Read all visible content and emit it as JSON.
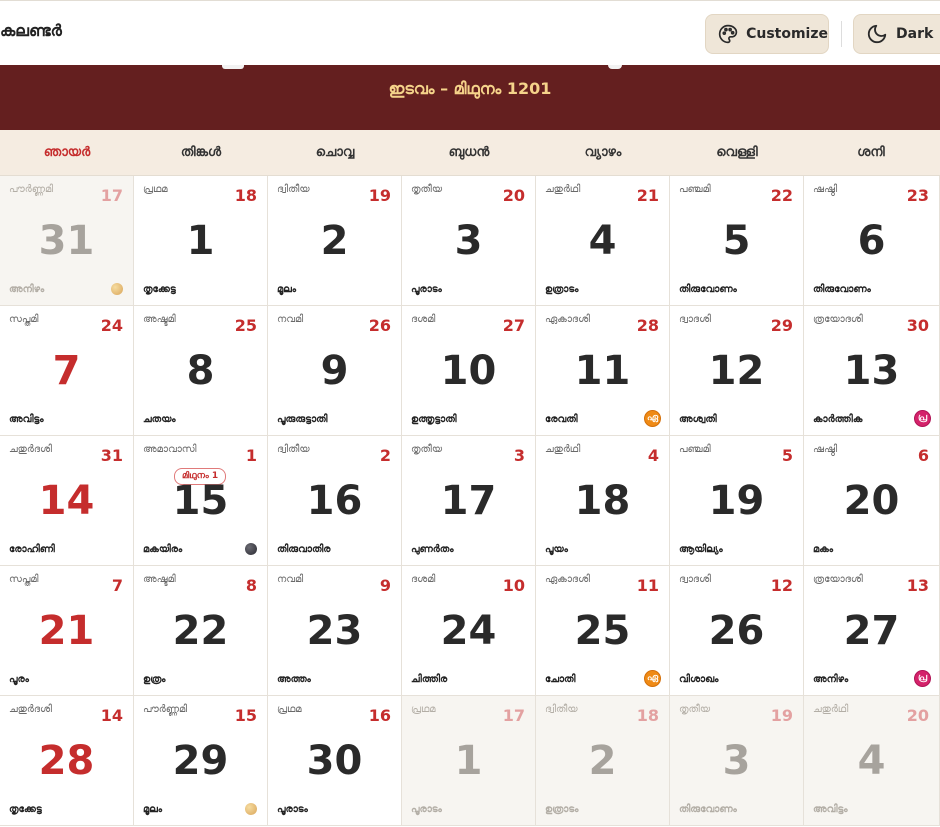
{
  "header": {
    "app_title": "കലണ്ടർ",
    "customize_label": "Customize",
    "dark_label": "Dark"
  },
  "banner": {
    "subtitle": "ഇടവം – മിഥുനം 1201"
  },
  "weekdays": [
    "ഞായർ",
    "തിങ്കൾ",
    "ചൊവ്വ",
    "ബുധൻ",
    "വ്യാഴം",
    "വെള്ളി",
    "ശനി"
  ],
  "colors": {
    "banner": "#641f1f",
    "accent_red": "#c52d2d",
    "header_bg": "#f5ece1",
    "button_bg": "#efe6d8"
  },
  "weeks": [
    [
      {
        "tithi": "പൗർണ്ണമി",
        "mdate": "17",
        "day": "31",
        "star": "അനിഴം",
        "other": true,
        "moon": "full"
      },
      {
        "tithi": "പ്രഥമ",
        "mdate": "18",
        "day": "1",
        "star": "തൃക്കേട്ട"
      },
      {
        "tithi": "ദ്വിതീയ",
        "mdate": "19",
        "day": "2",
        "star": "മൂലം"
      },
      {
        "tithi": "തൃതീയ",
        "mdate": "20",
        "day": "3",
        "star": "പൂരാടം"
      },
      {
        "tithi": "ചതുർഥി",
        "mdate": "21",
        "day": "4",
        "star": "ഉത്രാടം"
      },
      {
        "tithi": "പഞ്ചമി",
        "mdate": "22",
        "day": "5",
        "star": "തിരുവോണം"
      },
      {
        "tithi": "ഷഷ്ഠി",
        "mdate": "23",
        "day": "6",
        "star": "തിരുവോണം"
      }
    ],
    [
      {
        "tithi": "സപ്തമി",
        "mdate": "24",
        "day": "7",
        "star": "അവിട്ടം"
      },
      {
        "tithi": "അഷ്ടമി",
        "mdate": "25",
        "day": "8",
        "star": "ചതയം"
      },
      {
        "tithi": "നവമി",
        "mdate": "26",
        "day": "9",
        "star": "പൂരുരുട്ടാതി"
      },
      {
        "tithi": "ദശമി",
        "mdate": "27",
        "day": "10",
        "star": "ഉത്തൃട്ടാതി"
      },
      {
        "tithi": "ഏകാദശി",
        "mdate": "28",
        "day": "11",
        "star": "രേവതി",
        "badge": "orange",
        "badge_text": "ഏ"
      },
      {
        "tithi": "ദ്വാദശി",
        "mdate": "29",
        "day": "12",
        "star": "അശ്വതി"
      },
      {
        "tithi": "ത്രയോദശി",
        "mdate": "30",
        "day": "13",
        "star": "കാർത്തിക",
        "badge": "pink",
        "badge_text": "പ്ര"
      }
    ],
    [
      {
        "tithi": "ചതുർദശി",
        "mdate": "31",
        "day": "14",
        "star": "രോഹിണി"
      },
      {
        "tithi": "അമാവാസി",
        "mdate": "1",
        "day": "15",
        "star": "മകയിരം",
        "moon": "new",
        "pill": "മിഥുനം 1"
      },
      {
        "tithi": "ദ്വിതീയ",
        "mdate": "2",
        "day": "16",
        "star": "തിരുവാതിര"
      },
      {
        "tithi": "തൃതീയ",
        "mdate": "3",
        "day": "17",
        "star": "പുണർതം"
      },
      {
        "tithi": "ചതുർഥി",
        "mdate": "4",
        "day": "18",
        "star": "പൂയം"
      },
      {
        "tithi": "പഞ്ചമി",
        "mdate": "5",
        "day": "19",
        "star": "ആയില്യം"
      },
      {
        "tithi": "ഷഷ്ഠി",
        "mdate": "6",
        "day": "20",
        "star": "മകം"
      }
    ],
    [
      {
        "tithi": "സപ്തമി",
        "mdate": "7",
        "day": "21",
        "star": "പൂരം"
      },
      {
        "tithi": "അഷ്ടമി",
        "mdate": "8",
        "day": "22",
        "star": "ഉത്രം"
      },
      {
        "tithi": "നവമി",
        "mdate": "9",
        "day": "23",
        "star": "അത്തം"
      },
      {
        "tithi": "ദശമി",
        "mdate": "10",
        "day": "24",
        "star": "ചിത്തിര"
      },
      {
        "tithi": "ഏകാദശി",
        "mdate": "11",
        "day": "25",
        "star": "ചോതി",
        "badge": "orange",
        "badge_text": "ഏ"
      },
      {
        "tithi": "ദ്വാദശി",
        "mdate": "12",
        "day": "26",
        "star": "വിശാഖം"
      },
      {
        "tithi": "ത്രയോദശി",
        "mdate": "13",
        "day": "27",
        "star": "അനിഴം",
        "badge": "pink",
        "badge_text": "പ്ര"
      }
    ],
    [
      {
        "tithi": "ചതുർദശി",
        "mdate": "14",
        "day": "28",
        "star": "തൃക്കേട്ട"
      },
      {
        "tithi": "പൗർണ്ണമി",
        "mdate": "15",
        "day": "29",
        "star": "മൂലം",
        "moon": "full"
      },
      {
        "tithi": "പ്രഥമ",
        "mdate": "16",
        "day": "30",
        "star": "പൂരാടം"
      },
      {
        "tithi": "പ്രഥമ",
        "mdate": "17",
        "day": "1",
        "star": "പൂരാടം",
        "other": true
      },
      {
        "tithi": "ദ്വിതീയ",
        "mdate": "18",
        "day": "2",
        "star": "ഉത്രാടം",
        "other": true
      },
      {
        "tithi": "തൃതീയ",
        "mdate": "19",
        "day": "3",
        "star": "തിരുവോണം",
        "other": true
      },
      {
        "tithi": "ചതുർഥി",
        "mdate": "20",
        "day": "4",
        "star": "അവിട്ടം",
        "other": true
      }
    ]
  ]
}
